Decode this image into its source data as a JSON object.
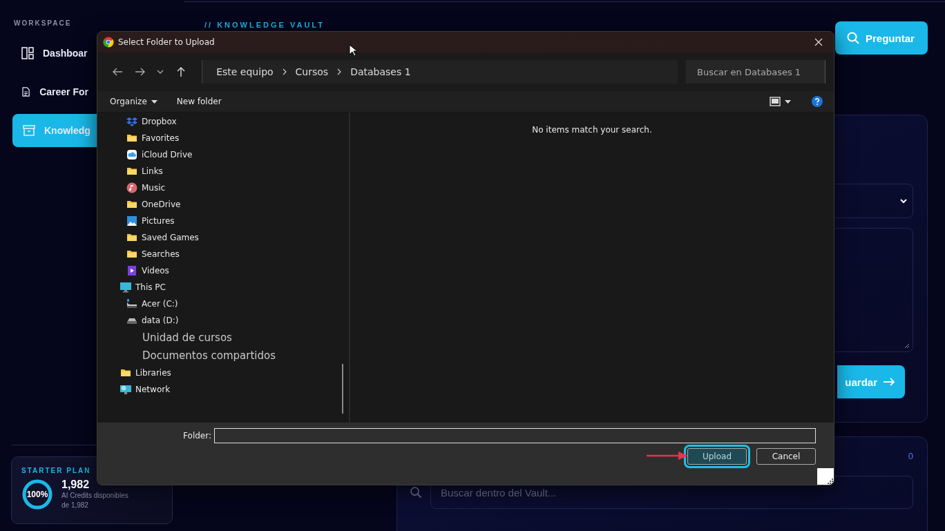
{
  "sidebar": {
    "section_label": "WORKSPACE",
    "items": [
      {
        "label": "Dashboar",
        "kind": "grid",
        "selected": false
      },
      {
        "label": "Career For",
        "kind": "document",
        "selected": false
      },
      {
        "label": "Knowledg",
        "kind": "archive",
        "selected": true
      }
    ],
    "plan": {
      "title": "STARTER PLAN",
      "level": 1,
      "percent": "100%",
      "credits": "1,982",
      "caption": "AI Credits disponibles",
      "caption_total": "de 1,982"
    }
  },
  "main": {
    "eyebrow": "// KNOWLEDGE VAULT",
    "ask_button": "Preguntar",
    "save_button": "uardar",
    "vault_count": "0",
    "vault_search": {
      "placeholder": "Buscar dentro del Vault..."
    }
  },
  "dialog": {
    "title": "Select Folder to Upload",
    "breadcrumb": [
      "Este equipo",
      "Cursos",
      "Databases 1"
    ],
    "search": {
      "placeholder": "Buscar en Databases 1"
    },
    "toolbar": {
      "organize": "Organize",
      "new_folder": "New folder"
    },
    "tree": [
      {
        "children": [
          {
            "label": "Dropbox",
            "kind": "dropbox"
          },
          {
            "label": "Favorites",
            "kind": "folder"
          },
          {
            "label": "iCloud Drive",
            "kind": "cloud"
          },
          {
            "label": "Links",
            "kind": "folder"
          },
          {
            "label": "Music",
            "kind": "music"
          },
          {
            "label": "OneDrive",
            "kind": "folder"
          },
          {
            "label": "Pictures",
            "kind": "pictures"
          },
          {
            "label": "Saved Games",
            "kind": "folder"
          },
          {
            "label": "Searches",
            "kind": "folder"
          },
          {
            "label": "Videos",
            "kind": "videos"
          }
        ]
      },
      {
        "label": "This PC",
        "kind": "pc",
        "children": [
          {
            "label": "Acer (C:)",
            "kind": "system_drive"
          },
          {
            "label": "data (D:)",
            "kind": "drive"
          }
        ]
      },
      {
        "kind": "overlay",
        "items": [
          "Unidad de cursos",
          "Documentos compartidos"
        ]
      },
      {
        "label": "Libraries",
        "kind": "folder"
      },
      {
        "label": "Network",
        "kind": "network"
      }
    ],
    "empty_message": "No items match your search.",
    "folder_label": "Folder:",
    "buttons": [
      {
        "label": "Upload",
        "highlighted": true
      },
      {
        "label": "Cancel",
        "highlighted": false
      }
    ]
  }
}
